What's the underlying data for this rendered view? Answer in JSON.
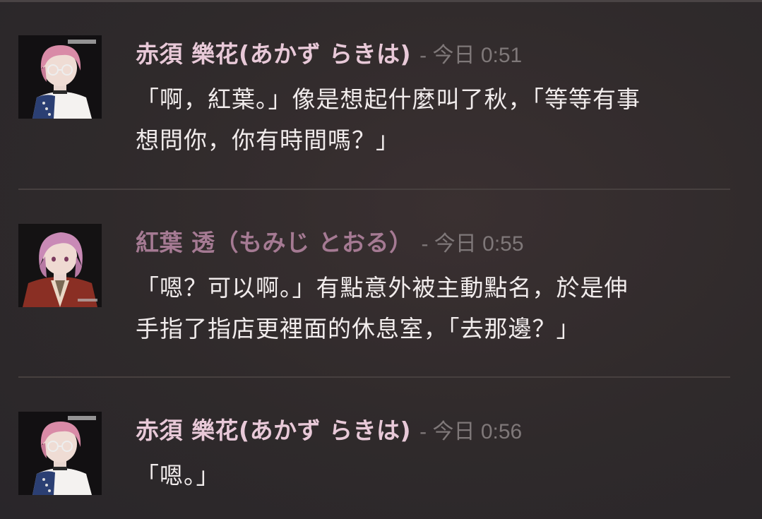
{
  "colors": {
    "background": "#2f2a2b",
    "author_rakiha": "#e8c9d8",
    "author_momiji": "#a57a93",
    "timestamp": "#7f7879",
    "body_text": "#f1ecec",
    "divider": "#47403f"
  },
  "messages": [
    {
      "author": "赤須 樂花(あかず らきは)",
      "timestamp": "- 今日 0:51",
      "lines": [
        "「啊，紅葉。」像是想起什麼叫了秋，「等等有事",
        "想問你，你有時間嗎？」"
      ],
      "avatar_icon": "avatar-pink-hair-glasses-icon"
    },
    {
      "author": "紅葉 透（もみじ とおる）",
      "timestamp": "- 今日 0:55",
      "lines": [
        "「嗯？可以啊。」有點意外被主動點名，於是伸",
        "手指了指店更裡面的休息室，「去那邊？」"
      ],
      "avatar_icon": "avatar-pink-hair-kimono-icon"
    },
    {
      "author": "赤須 樂花(あかず らきは)",
      "timestamp": "- 今日 0:56",
      "lines": [
        "「嗯。」"
      ],
      "avatar_icon": "avatar-pink-hair-glasses-icon"
    }
  ]
}
